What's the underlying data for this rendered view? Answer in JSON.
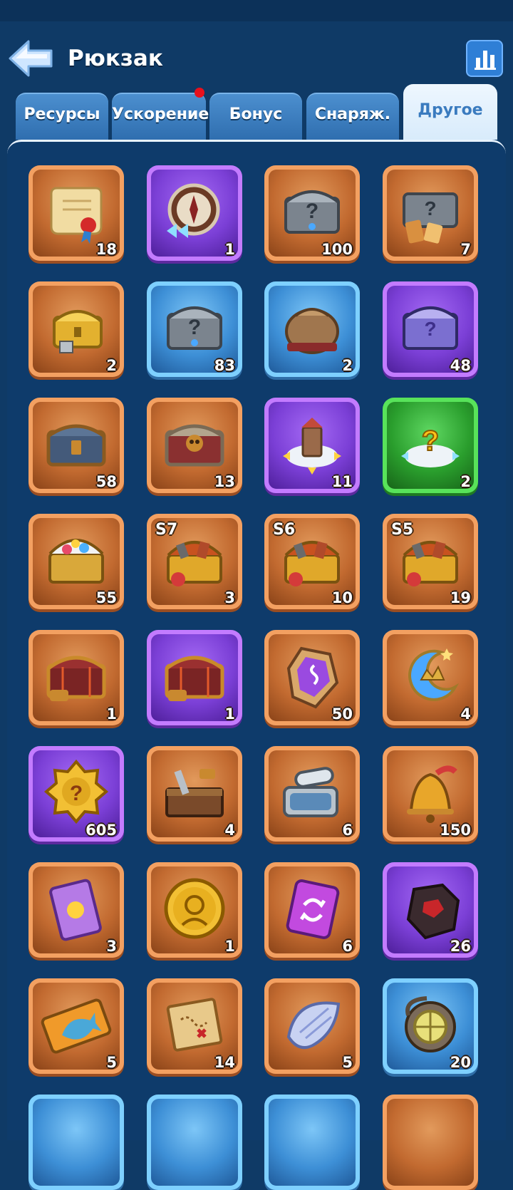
{
  "header": {
    "title": "Рюкзак"
  },
  "tabs": [
    {
      "label": "Ресурсы",
      "active": false
    },
    {
      "label": "Ускорение",
      "active": false,
      "badge": true
    },
    {
      "label": "Бонус",
      "active": false
    },
    {
      "label": "Снаряж.",
      "active": false
    },
    {
      "label": "Другое",
      "active": true
    }
  ],
  "items": [
    {
      "icon": "scroll-icon",
      "rarity": "orange",
      "count": "18"
    },
    {
      "icon": "compass-speed-icon",
      "rarity": "purple",
      "count": "1"
    },
    {
      "icon": "mystery-steel-chest-icon",
      "rarity": "orange",
      "count": "100"
    },
    {
      "icon": "mystery-steel-chest-cards-icon",
      "rarity": "orange",
      "count": "7"
    },
    {
      "icon": "golden-chest-icon",
      "rarity": "orange",
      "count": "2"
    },
    {
      "icon": "mystery-steel-chest-icon",
      "rarity": "blue",
      "count": "83"
    },
    {
      "icon": "sack-icon",
      "rarity": "blue",
      "count": "2"
    },
    {
      "icon": "mystery-purple-chest-icon",
      "rarity": "purple",
      "count": "48"
    },
    {
      "icon": "bronze-chest-icon",
      "rarity": "orange",
      "count": "58"
    },
    {
      "icon": "skull-chest-icon",
      "rarity": "orange",
      "count": "13"
    },
    {
      "icon": "building-relocate-icon",
      "rarity": "purple",
      "count": "11"
    },
    {
      "icon": "random-relocate-icon",
      "rarity": "green",
      "count": "2"
    },
    {
      "icon": "treasure-chest-icon",
      "rarity": "orange",
      "count": "55"
    },
    {
      "icon": "season-chest-icon",
      "rarity": "orange",
      "count": "3",
      "season": "S7"
    },
    {
      "icon": "season-chest-icon",
      "rarity": "orange",
      "count": "10",
      "season": "S6"
    },
    {
      "icon": "season-chest-icon",
      "rarity": "orange",
      "count": "19",
      "season": "S5"
    },
    {
      "icon": "red-treasure-chest-icon",
      "rarity": "orange",
      "count": "1"
    },
    {
      "icon": "red-treasure-chest-icon",
      "rarity": "purple",
      "count": "1"
    },
    {
      "icon": "rune-stone-icon",
      "rarity": "orange",
      "count": "50"
    },
    {
      "icon": "crescent-crown-icon",
      "rarity": "orange",
      "count": "4"
    },
    {
      "icon": "mystery-medal-icon",
      "rarity": "purple",
      "count": "605"
    },
    {
      "icon": "toolbox-icon",
      "rarity": "orange",
      "count": "4"
    },
    {
      "icon": "sardine-can-icon",
      "rarity": "orange",
      "count": "6"
    },
    {
      "icon": "bell-icon",
      "rarity": "orange",
      "count": "150"
    },
    {
      "icon": "purple-card-icon",
      "rarity": "orange",
      "count": "3"
    },
    {
      "icon": "gold-coin-icon",
      "rarity": "orange",
      "count": "1"
    },
    {
      "icon": "exchange-ticket-icon",
      "rarity": "orange",
      "count": "6"
    },
    {
      "icon": "dark-ore-icon",
      "rarity": "purple",
      "count": "26"
    },
    {
      "icon": "fish-ticket-icon",
      "rarity": "orange",
      "count": "5"
    },
    {
      "icon": "treasure-map-icon",
      "rarity": "orange",
      "count": "14"
    },
    {
      "icon": "shell-icon",
      "rarity": "orange",
      "count": "5"
    },
    {
      "icon": "diving-helmet-icon",
      "rarity": "blue",
      "count": "20"
    },
    {
      "icon": "partial-item-icon",
      "rarity": "blue",
      "count": ""
    },
    {
      "icon": "partial-item-icon",
      "rarity": "blue",
      "count": ""
    },
    {
      "icon": "partial-item-icon",
      "rarity": "blue",
      "count": ""
    },
    {
      "icon": "partial-item-icon",
      "rarity": "orange",
      "count": ""
    }
  ]
}
